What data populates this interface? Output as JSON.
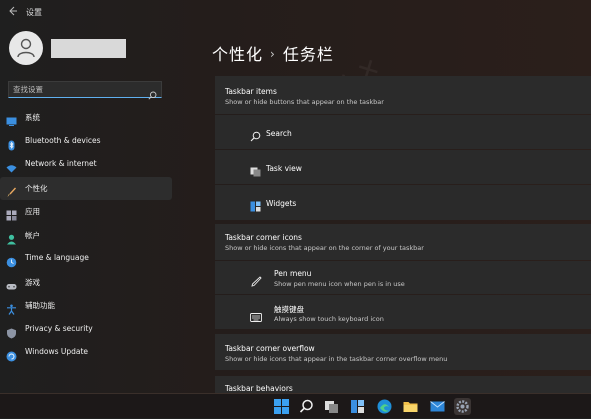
{
  "app": {
    "title": "设置"
  },
  "search": {
    "placeholder": "查找设置"
  },
  "sidebar": {
    "items": [
      {
        "label": "系统",
        "icon": "display-icon"
      },
      {
        "label": "Bluetooth & devices",
        "icon": "bluetooth-icon"
      },
      {
        "label": "Network & internet",
        "icon": "wifi-icon"
      },
      {
        "label": "个性化",
        "icon": "brush-icon",
        "active": true
      },
      {
        "label": "应用",
        "icon": "apps-icon"
      },
      {
        "label": "帐户",
        "icon": "person-icon"
      },
      {
        "label": "Time & language",
        "icon": "globe-clock-icon"
      },
      {
        "label": "游戏",
        "icon": "gamepad-icon"
      },
      {
        "label": "辅助功能",
        "icon": "accessibility-icon"
      },
      {
        "label": "Privacy & security",
        "icon": "shield-icon"
      },
      {
        "label": "Windows Update",
        "icon": "update-icon"
      }
    ]
  },
  "breadcrumb": {
    "parent": "个性化",
    "separator": "›",
    "current": "任务栏"
  },
  "sections": {
    "taskbar_items": {
      "title": "Taskbar items",
      "description": "Show or hide buttons that appear on the taskbar",
      "rows": [
        {
          "label": "Search",
          "icon": "search-icon"
        },
        {
          "label": "Task view",
          "icon": "task-view-icon"
        },
        {
          "label": "Widgets",
          "icon": "widgets-icon"
        }
      ]
    },
    "corner_icons": {
      "title": "Taskbar corner icons",
      "description": "Show or hide icons that appear on the corner of your taskbar",
      "rows": [
        {
          "label": "Pen menu",
          "description": "Show pen menu icon when pen is in use",
          "icon": "pen-icon"
        },
        {
          "label": "触摸键盘",
          "description": "Always show touch keyboard icon",
          "icon": "keyboard-icon"
        }
      ]
    },
    "corner_overflow": {
      "title": "Taskbar corner overflow",
      "description": "Show or hide icons that appear in the taskbar corner overflow menu"
    },
    "behaviors": {
      "title": "Taskbar behaviors"
    }
  },
  "taskbar": {
    "icons": [
      "start-icon",
      "search-icon",
      "task-view-icon",
      "widgets-icon",
      "edge-icon",
      "file-explorer-icon",
      "mail-icon",
      "settings-icon"
    ]
  },
  "colors": {
    "accent": "#5fb0f0",
    "background": "#202020",
    "card": "#2b2b2b"
  }
}
